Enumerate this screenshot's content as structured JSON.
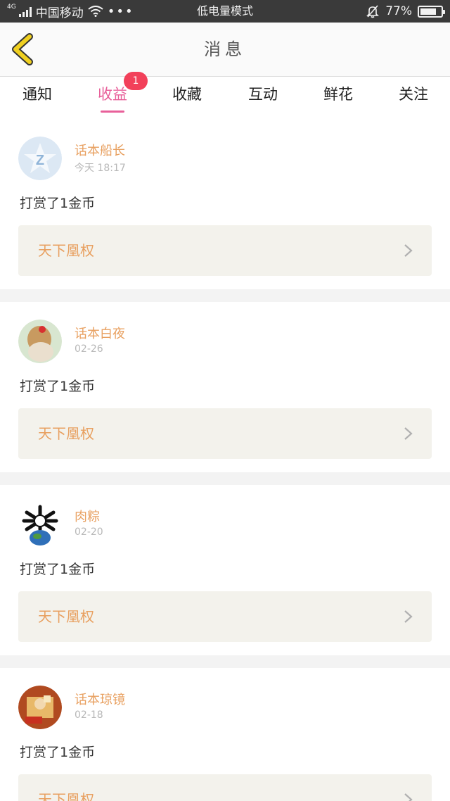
{
  "status_bar": {
    "network": "4G",
    "carrier": "中国移动",
    "more": "•••",
    "mode": "低电量模式",
    "battery": "77%",
    "battery_level": 0.77
  },
  "header": {
    "title": "消息"
  },
  "tabs": [
    {
      "label": "通知"
    },
    {
      "label": "收益",
      "badge": "1"
    },
    {
      "label": "收藏"
    },
    {
      "label": "互动"
    },
    {
      "label": "鲜花"
    },
    {
      "label": "关注"
    }
  ],
  "active_tab": "收益",
  "messages": [
    {
      "user": "话本船长",
      "time": "今天 18:17",
      "action": "打赏了1金币",
      "book": "天下凰权"
    },
    {
      "user": "话本白夜",
      "time": "02-26",
      "action": "打赏了1金币",
      "book": "天下凰权"
    },
    {
      "user": "肉粽",
      "time": "02-20",
      "action": "打赏了1金币",
      "book": "天下凰权"
    },
    {
      "user": "话本琼镜",
      "time": "02-18",
      "action": "打赏了1金币",
      "book": "天下凰权"
    }
  ],
  "colors": {
    "accent": "#e8609a",
    "badge": "#f2405a",
    "name": "#e8a060",
    "back_arrow": "#f0d020"
  }
}
